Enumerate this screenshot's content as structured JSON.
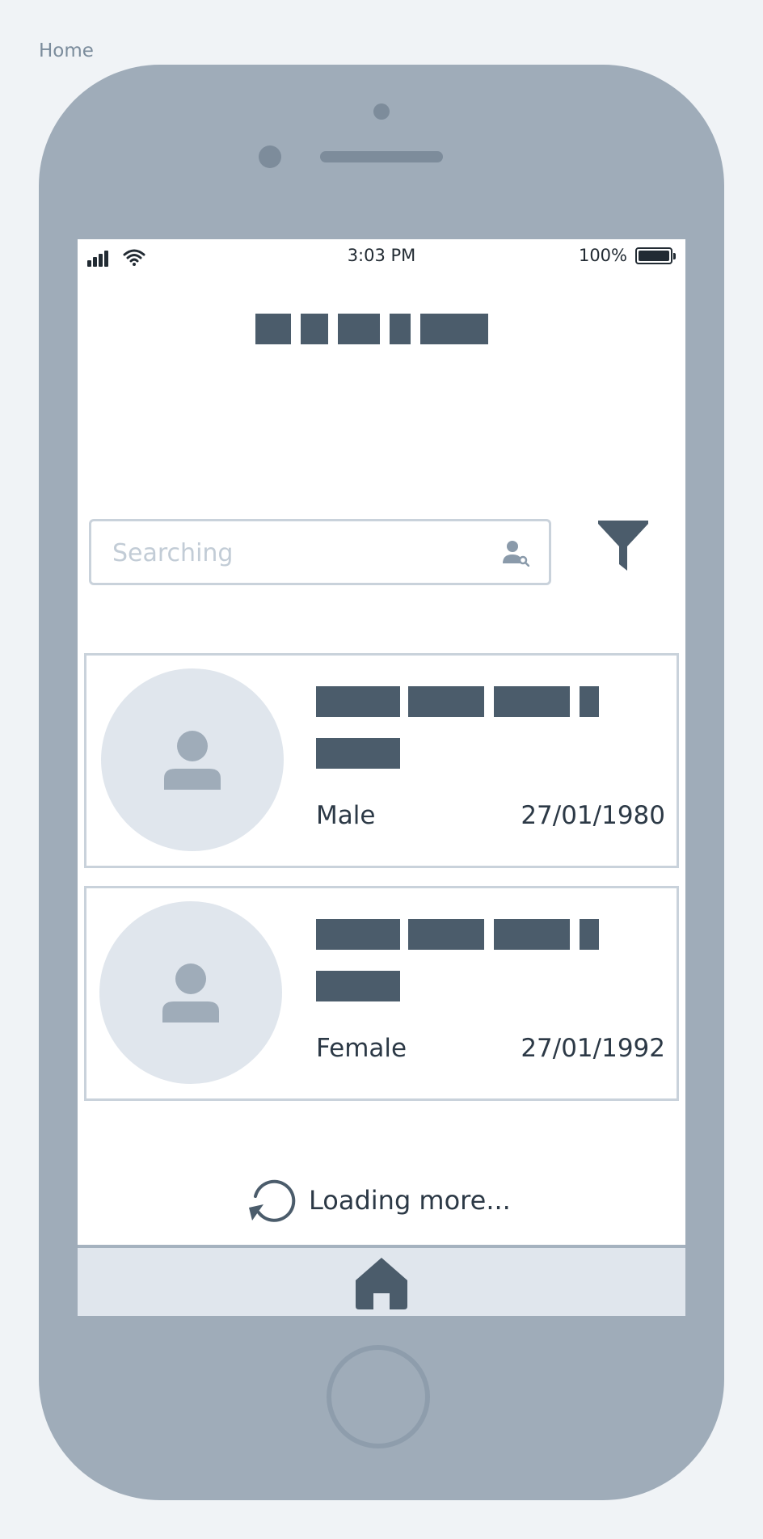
{
  "page_label": "Home",
  "status_bar": {
    "time": "3:03 PM",
    "battery": "100%"
  },
  "search": {
    "placeholder": "Searching",
    "value": ""
  },
  "patients": [
    {
      "gender": "Male",
      "dob": "27/01/1980"
    },
    {
      "gender": "Female",
      "dob": "27/01/1992"
    }
  ],
  "loading_text": "Loading more...",
  "icons": {
    "search_field": "user-search-icon",
    "filter": "filter-icon",
    "loading": "refresh-icon",
    "tab": "home-icon",
    "avatar": "person-icon"
  },
  "colors": {
    "accent_dark": "#4b5c6b",
    "frame": "#9facb9",
    "placeholder": "#c2ccd6",
    "avatar_bg": "#e0e6ed"
  }
}
